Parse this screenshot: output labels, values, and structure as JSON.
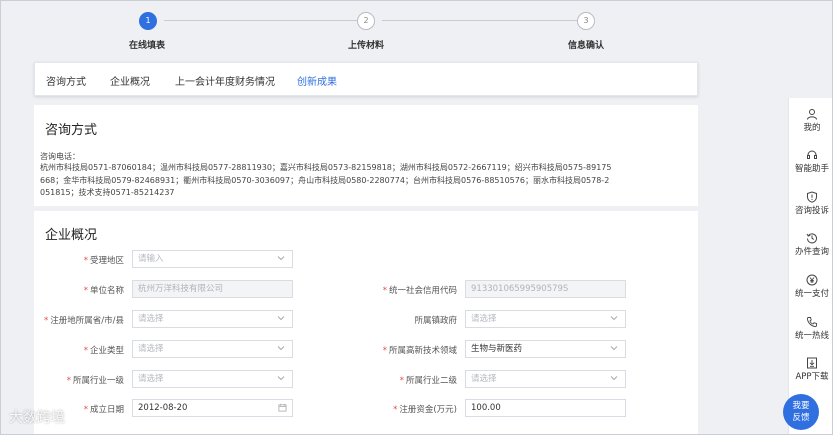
{
  "steps": [
    {
      "number": "1",
      "label": "在线填表"
    },
    {
      "number": "2",
      "label": "上传材料"
    },
    {
      "number": "3",
      "label": "信息确认"
    }
  ],
  "tabs": [
    "咨询方式",
    "企业概况",
    "上一会计年度财务情况",
    "创新成果"
  ],
  "contact": {
    "title": "咨询方式",
    "label": "咨询电话：",
    "lines": [
      "杭州市科技局0571-87060184；温州市科技局0577-28811930；嘉兴市科技局0573-82159818；湖州市科技局0572-2667119；绍兴市科技局0575-89175",
      "668；金华市科技局0579-82468931；衢州市科技局0570-3036097；舟山市科技局0580-2280774；台州市科技局0576-88510576；丽水市科技局0578-2",
      "051815；技术支持0571-85214237"
    ]
  },
  "company": {
    "title": "企业概况",
    "fields": {
      "region": {
        "label": "受理地区",
        "placeholder": "请输入"
      },
      "name": {
        "label": "单位名称",
        "value": "杭州万洋科技有限公司"
      },
      "credit_code": {
        "label": "统一社会信用代码",
        "value": "91330106599590579S"
      },
      "location": {
        "label": "注册地所属省/市/县",
        "placeholder": "请选择"
      },
      "town": {
        "label": "所属镇政府",
        "placeholder": "请选择"
      },
      "type": {
        "label": "企业类型",
        "placeholder": "请选择"
      },
      "tech_field": {
        "label": "所属高新技术领域",
        "value": "生物与新医药"
      },
      "industry1": {
        "label": "所属行业一级",
        "placeholder": "请选择"
      },
      "industry2": {
        "label": "所属行业二级",
        "placeholder": "请选择"
      },
      "founded": {
        "label": "成立日期",
        "value": "2012-08-20"
      },
      "capital": {
        "label": "注册资金(万元)",
        "value": "100.00"
      }
    }
  },
  "sidebar": [
    {
      "label": "我的",
      "icon": "user-icon"
    },
    {
      "label": "智能助手",
      "icon": "headset-icon"
    },
    {
      "label": "咨询投诉",
      "icon": "shield-icon"
    },
    {
      "label": "办件查询",
      "icon": "history-icon"
    },
    {
      "label": "统一支付",
      "icon": "yen-icon"
    },
    {
      "label": "统一热线",
      "icon": "phone-icon"
    },
    {
      "label": "APP下载",
      "icon": "download-icon"
    }
  ],
  "feedback": {
    "line1": "我要",
    "line2": "反馈"
  },
  "watermark": "大数跨境",
  "colors": {
    "accent": "#2f6fe0",
    "required": "#e34b4b"
  }
}
